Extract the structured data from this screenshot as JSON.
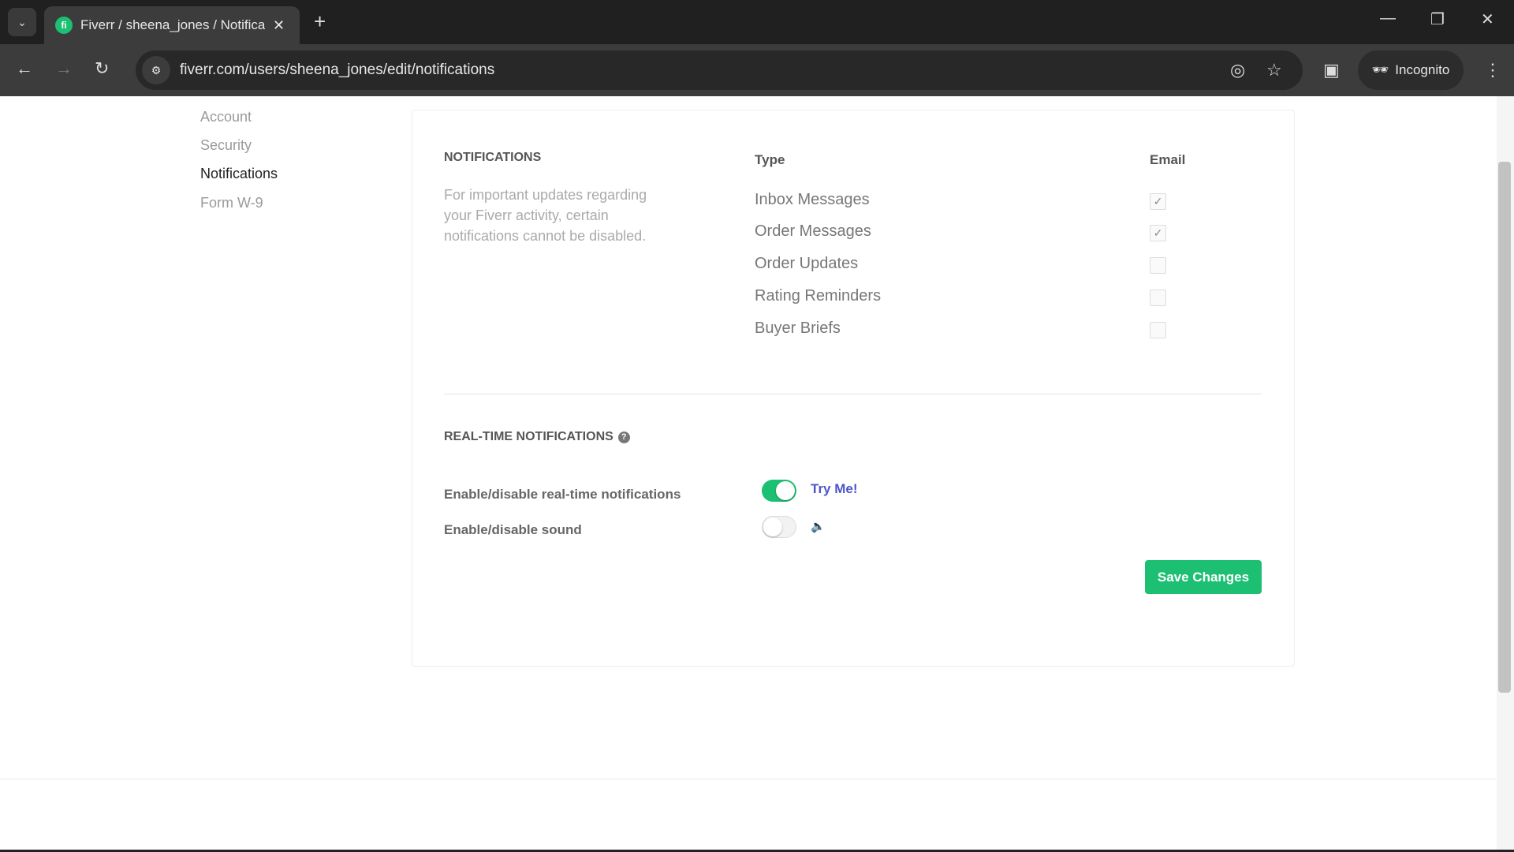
{
  "browser": {
    "tab_title": "Fiverr / sheena_jones / Notifications",
    "favicon": "fi",
    "url": "fiverr.com/users/sheena_jones/edit/notifications",
    "incognito_label": "Incognito"
  },
  "sidebar": {
    "items": [
      {
        "label": "Account",
        "active": false
      },
      {
        "label": "Security",
        "active": false
      },
      {
        "label": "Notifications",
        "active": true
      },
      {
        "label": "Form W-9",
        "active": false
      }
    ]
  },
  "notifications": {
    "heading": "NOTIFICATIONS",
    "description": "For important updates regarding your Fiverr activity, certain notifications cannot be disabled.",
    "col_type": "Type",
    "col_email": "Email",
    "rows": [
      {
        "label": "Inbox Messages",
        "email": true
      },
      {
        "label": "Order Messages",
        "email": true
      },
      {
        "label": "Order Updates",
        "email": false
      },
      {
        "label": "Rating Reminders",
        "email": false
      },
      {
        "label": "Buyer Briefs",
        "email": false
      }
    ]
  },
  "realtime": {
    "heading": "REAL-TIME NOTIFICATIONS",
    "realtime_label": "Enable/disable real-time notifications",
    "realtime_on": true,
    "try_me": "Try Me!",
    "sound_label": "Enable/disable sound",
    "sound_on": false
  },
  "save_label": "Save Changes",
  "colors": {
    "accent": "#1dbf73",
    "link": "#4a56c8"
  }
}
